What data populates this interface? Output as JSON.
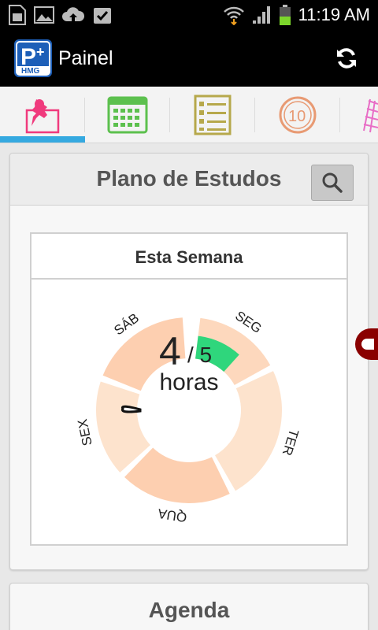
{
  "status_bar": {
    "time": "11:19 AM",
    "icons": [
      "sim-card-icon",
      "image-icon",
      "cloud-upload-icon",
      "checkbox-icon",
      "wifi-icon",
      "signal-icon",
      "battery-icon"
    ]
  },
  "action_bar": {
    "logo_label": "HMG",
    "title": "Painel",
    "refresh_icon": "refresh-icon"
  },
  "tabs": [
    {
      "icon": "pin-icon",
      "active": true
    },
    {
      "icon": "calendar-icon",
      "active": false
    },
    {
      "icon": "checklist-icon",
      "active": false
    },
    {
      "icon": "timer-10-icon",
      "active": false
    },
    {
      "icon": "grid-icon",
      "active": false
    }
  ],
  "plano": {
    "title": "Plano de Estudos",
    "search_icon": "search-icon",
    "week_label": "Esta Semana",
    "hours_done": "4",
    "hours_separator": "/ 5",
    "hours_unit": "horas"
  },
  "chart_data": {
    "type": "pie",
    "categories": [
      "SEG",
      "TER",
      "QUA",
      "SEX",
      "SÁB"
    ],
    "progress": [
      0.65,
      0,
      0,
      0,
      0
    ],
    "colors": {
      "progress": "#2fd67c",
      "seg": "#fdd8bd",
      "ter": "#fde3cd",
      "qua": "#fdcfb0",
      "sex": "#fde3cd",
      "sab": "#fdcfb0"
    },
    "total_label": "4 / 5 horas"
  },
  "agenda": {
    "title": "Agenda"
  },
  "colors": {
    "tab_indicator": "#35a9e0",
    "action_bar": "#000000"
  }
}
